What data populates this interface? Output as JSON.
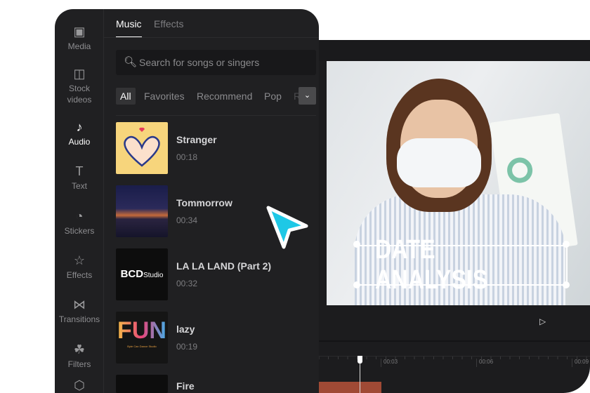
{
  "sidebar": {
    "items": [
      {
        "label": "Media",
        "icon": "media-icon"
      },
      {
        "label": "Stock videos",
        "icon": "stock-videos-icon"
      },
      {
        "label": "Audio",
        "icon": "audio-icon",
        "active": true
      },
      {
        "label": "Text",
        "icon": "text-icon"
      },
      {
        "label": "Stickers",
        "icon": "stickers-icon"
      },
      {
        "label": "Effects",
        "icon": "effects-icon"
      },
      {
        "label": "Transitions",
        "icon": "transitions-icon"
      },
      {
        "label": "Filters",
        "icon": "filters-icon"
      }
    ]
  },
  "tabs": [
    {
      "label": "Music",
      "active": true
    },
    {
      "label": "Effects"
    }
  ],
  "search": {
    "placeholder": "Search for songs or singers"
  },
  "chips": [
    "All",
    "Favorites",
    "Recommend",
    "Pop",
    "R"
  ],
  "songs": [
    {
      "title": "Stranger",
      "duration": "00:18"
    },
    {
      "title": "Tommorrow",
      "duration": "00:34"
    },
    {
      "title": "LA LA LAND (Part 2)",
      "duration": "00:32"
    },
    {
      "title": "lazy",
      "duration": "00:19"
    },
    {
      "title": "Fire",
      "duration": ""
    }
  ],
  "thumbs": {
    "bcd": "BCD",
    "bcd2": "Studio",
    "fun": "FUN",
    "fun_sub": "Byte Can Dance Studio"
  },
  "video": {
    "title_overlay": "DATE ANALYSIS"
  },
  "timeline": {
    "ticks": [
      "00:03",
      "00:06",
      "00:09"
    ]
  },
  "colors": {
    "accent_cursor": "#1ec8e6",
    "clip": "#a04a35"
  }
}
